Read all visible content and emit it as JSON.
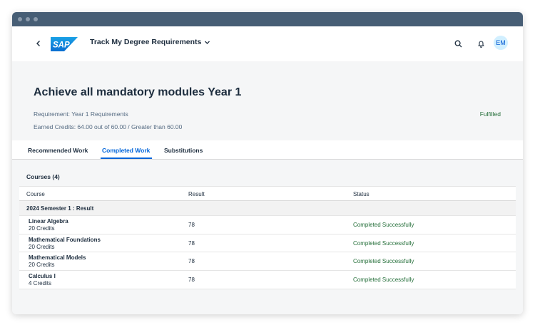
{
  "shell": {
    "title": "Track My Degree Requirements",
    "avatar_initials": "EM",
    "logo_text": "SAP"
  },
  "header": {
    "title": "Achieve all mandatory modules Year 1",
    "requirement": "Requirement: Year 1 Requirements",
    "credits": "Earned Credits: 64.00 out of 60.00 / Greater than 60.00",
    "status": "Fulfilled"
  },
  "tabs": [
    {
      "label": "Recommended Work"
    },
    {
      "label": "Completed Work",
      "active": true
    },
    {
      "label": "Substitutions"
    }
  ],
  "courses": {
    "heading": "Courses (4)",
    "columns": [
      "Course",
      "Result",
      "Status"
    ],
    "group": "2024 Semester 1 : Result",
    "rows": [
      {
        "name": "Linear Algebra",
        "credits": "20 Credits",
        "result": "78",
        "status": "Completed Successfully"
      },
      {
        "name": "Mathematical Foundations",
        "credits": "20 Credits",
        "result": "78",
        "status": "Completed Successfully"
      },
      {
        "name": "Mathematical Models",
        "credits": "20 Credits",
        "result": "78",
        "status": "Completed Successfully"
      },
      {
        "name": "Calculus I",
        "credits": "4 Credits",
        "result": "78",
        "status": "Completed Successfully"
      }
    ]
  },
  "colors": {
    "accent": "#0064d9",
    "success": "#256f3a",
    "titlebar": "#475e75"
  }
}
